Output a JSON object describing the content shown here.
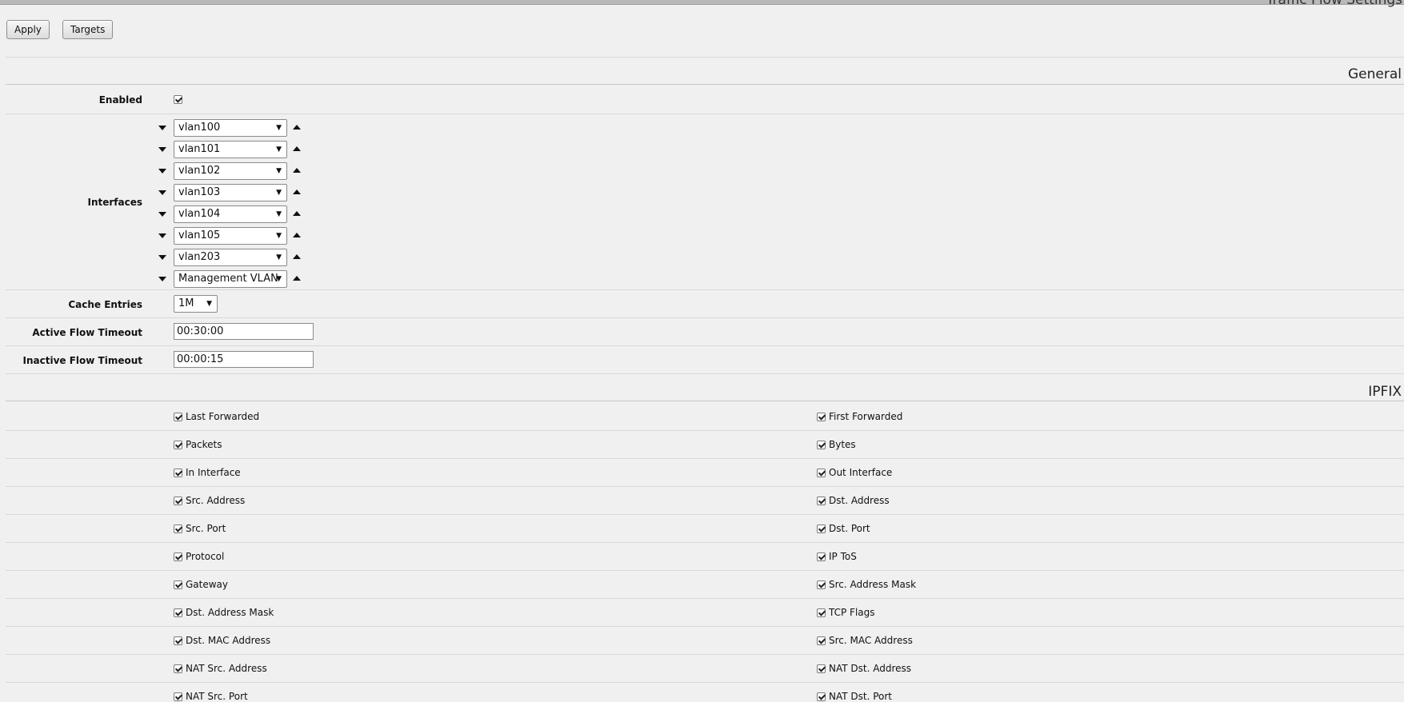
{
  "window": {
    "title_fragment": "Traffic Flow Settings"
  },
  "toolbar": {
    "apply_label": "Apply",
    "targets_label": "Targets"
  },
  "general": {
    "heading": "General",
    "enabled": {
      "label": "Enabled",
      "checked": true
    },
    "interfaces": {
      "label": "Interfaces",
      "items": [
        "vlan100",
        "vlan101",
        "vlan102",
        "vlan103",
        "vlan104",
        "vlan105",
        "vlan203",
        "Management VLAN"
      ]
    },
    "cache_entries": {
      "label": "Cache Entries",
      "value": "1M"
    },
    "active_flow_timeout": {
      "label": "Active Flow Timeout",
      "value": "00:30:00"
    },
    "inactive_flow_timeout": {
      "label": "Inactive Flow Timeout",
      "value": "00:00:15"
    }
  },
  "ipfix": {
    "heading": "IPFIX",
    "rows": [
      {
        "left": "Last Forwarded",
        "right": "First Forwarded"
      },
      {
        "left": "Packets",
        "right": "Bytes"
      },
      {
        "left": "In Interface",
        "right": "Out Interface"
      },
      {
        "left": "Src. Address",
        "right": "Dst. Address"
      },
      {
        "left": "Src. Port",
        "right": "Dst. Port"
      },
      {
        "left": "Protocol",
        "right": "IP ToS"
      },
      {
        "left": "Gateway",
        "right": "Src. Address Mask"
      },
      {
        "left": "Dst. Address Mask",
        "right": "TCP Flags"
      },
      {
        "left": "Dst. MAC Address",
        "right": "Src. MAC Address"
      },
      {
        "left": "NAT Src. Address",
        "right": "NAT Dst. Address"
      },
      {
        "left": "NAT Src. Port",
        "right": "NAT Dst. Port"
      }
    ]
  }
}
